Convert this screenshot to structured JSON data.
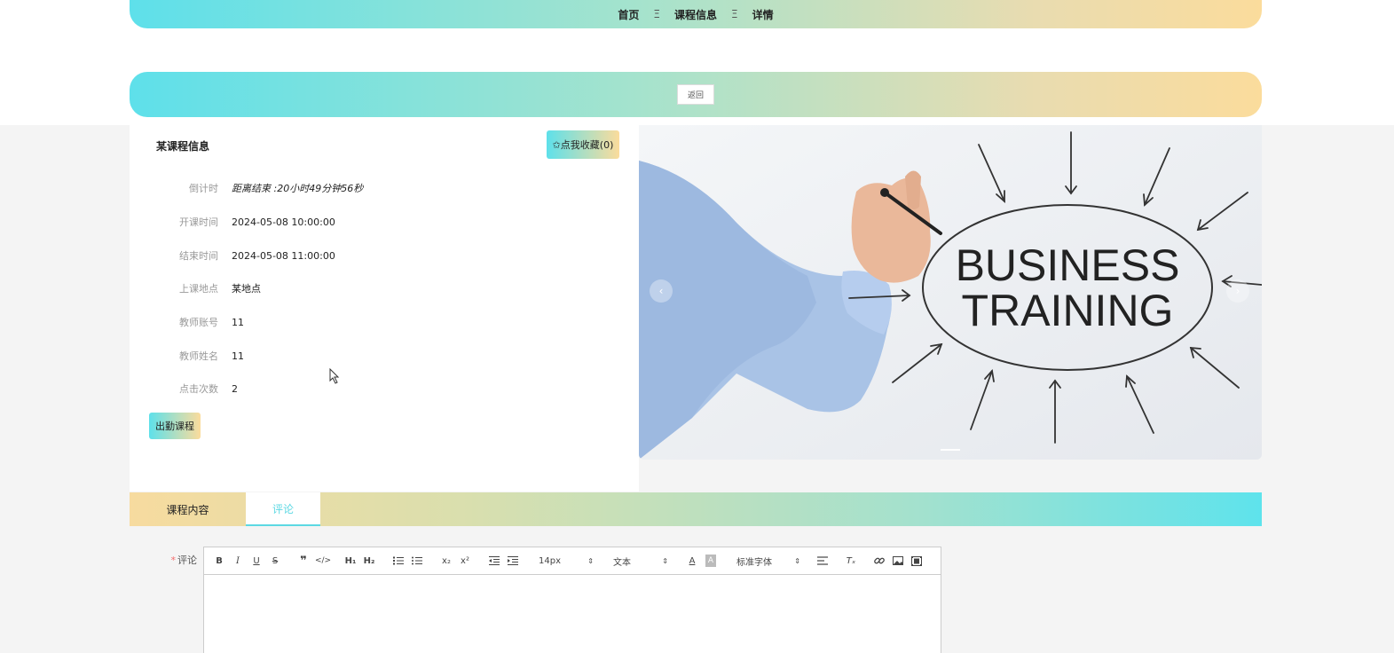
{
  "breadcrumb": {
    "home": "首页",
    "separator": "Ξ",
    "section": "课程信息",
    "current": "详情"
  },
  "back_button": "返回",
  "course": {
    "title": "某课程信息",
    "favorite_label": "✩点我收藏(0)",
    "fields": [
      {
        "label": "倒计时",
        "value": "距离结束 :20小时49分钟56秒"
      },
      {
        "label": "开课时间",
        "value": "2024-05-08 10:00:00"
      },
      {
        "label": "结束时间",
        "value": "2024-05-08 11:00:00"
      },
      {
        "label": "上课地点",
        "value": "某地点"
      },
      {
        "label": "教师账号",
        "value": "11"
      },
      {
        "label": "教师姓名",
        "value": "11"
      },
      {
        "label": "点击次数",
        "value": "2"
      }
    ],
    "attend_label": "出勤课程"
  },
  "carousel": {
    "image_text_line1": "BUSINESS",
    "image_text_line2": "TRAINING",
    "prev": "‹",
    "next": "›"
  },
  "tabs": [
    {
      "label": "课程内容",
      "active": false
    },
    {
      "label": "评论",
      "active": true
    }
  ],
  "comment": {
    "required_mark": "*",
    "label": "评论",
    "toolbar": {
      "font_size": "14px",
      "block_type": "文本",
      "font_family": "标准字体"
    }
  }
}
